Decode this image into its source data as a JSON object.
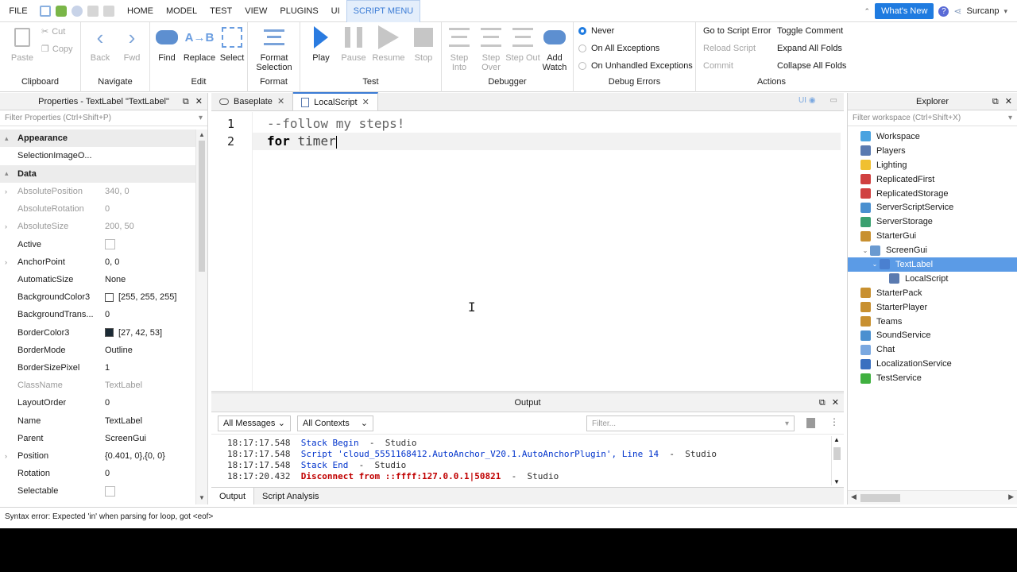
{
  "menu": {
    "file": "FILE",
    "tabs": [
      "HOME",
      "MODEL",
      "TEST",
      "VIEW",
      "PLUGINS",
      "UI",
      "SCRIPT MENU"
    ],
    "active_tab": "SCRIPT MENU",
    "whats_new": "What's New",
    "username": "Surcanp"
  },
  "ribbon": {
    "clipboard": {
      "label": "Clipboard",
      "paste": "Paste",
      "cut": "Cut",
      "copy": "Copy"
    },
    "navigate": {
      "label": "Navigate",
      "back": "Back",
      "fwd": "Fwd"
    },
    "edit": {
      "label": "Edit",
      "find": "Find",
      "replace": "Replace",
      "select": "Select"
    },
    "format": {
      "label": "Format",
      "format_selection": "Format Selection"
    },
    "test": {
      "label": "Test",
      "play": "Play",
      "pause": "Pause",
      "resume": "Resume",
      "stop": "Stop"
    },
    "debugger": {
      "label": "Debugger",
      "step_into": "Step Into",
      "step_over": "Step Over",
      "step_out": "Step Out",
      "add_watch": "Add Watch"
    },
    "debug_errors": {
      "label": "Debug Errors",
      "never": "Never",
      "on_all": "On All Exceptions",
      "on_unhandled": "On Unhandled Exceptions"
    },
    "actions": {
      "label": "Actions",
      "go_to_error": "Go to Script Error",
      "reload": "Reload Script",
      "commit": "Commit",
      "toggle_comment": "Toggle Comment",
      "expand_folds": "Expand All Folds",
      "collapse_folds": "Collapse All Folds"
    }
  },
  "properties": {
    "title": "Properties - TextLabel \"TextLabel\"",
    "filter_placeholder": "Filter Properties (Ctrl+Shift+P)",
    "rows": [
      {
        "type": "cat",
        "name": "Appearance"
      },
      {
        "name": "SelectionImageO...",
        "value": ""
      },
      {
        "type": "cat",
        "name": "Data"
      },
      {
        "name": "AbsolutePosition",
        "value": "340, 0",
        "ro": true,
        "exp": true
      },
      {
        "name": "AbsoluteRotation",
        "value": "0",
        "ro": true
      },
      {
        "name": "AbsoluteSize",
        "value": "200, 50",
        "ro": true,
        "exp": true
      },
      {
        "name": "Active",
        "value": "",
        "check": true
      },
      {
        "name": "AnchorPoint",
        "value": "0, 0",
        "exp": true
      },
      {
        "name": "AutomaticSize",
        "value": "None"
      },
      {
        "name": "BackgroundColor3",
        "value": "[255, 255, 255]",
        "swatch": "#ffffff"
      },
      {
        "name": "BackgroundTrans...",
        "value": "0"
      },
      {
        "name": "BorderColor3",
        "value": "[27, 42, 53]",
        "swatch": "#1b2a35"
      },
      {
        "name": "BorderMode",
        "value": "Outline"
      },
      {
        "name": "BorderSizePixel",
        "value": "1"
      },
      {
        "name": "ClassName",
        "value": "TextLabel",
        "ro": true
      },
      {
        "name": "LayoutOrder",
        "value": "0"
      },
      {
        "name": "Name",
        "value": "TextLabel"
      },
      {
        "name": "Parent",
        "value": "ScreenGui"
      },
      {
        "name": "Position",
        "value": "{0.401, 0},{0, 0}",
        "exp": true
      },
      {
        "name": "Rotation",
        "value": "0"
      },
      {
        "name": "Selectable",
        "value": "",
        "check": true
      }
    ]
  },
  "editor": {
    "tabs": [
      {
        "label": "Baseplate",
        "icon": "cloud-icon"
      },
      {
        "label": "LocalScript",
        "icon": "script-icon",
        "active": true
      }
    ],
    "ui_toggle": "UI",
    "lines": [
      {
        "num": "1",
        "comment": "--follow my steps!"
      },
      {
        "num": "2",
        "keyword": "for",
        "rest": " timer"
      }
    ]
  },
  "output": {
    "title": "Output",
    "messages_filter": "All Messages",
    "contexts_filter": "All Contexts",
    "filter_placeholder": "Filter...",
    "log": [
      {
        "ts": "18:17:17.548",
        "msg": "Stack Begin",
        "src": "Studio",
        "err": false
      },
      {
        "ts": "18:17:17.548",
        "msg": "Script 'cloud_5551168412.AutoAnchor_V20.1.AutoAnchorPlugin', Line 14",
        "src": "Studio",
        "err": false
      },
      {
        "ts": "18:17:17.548",
        "msg": "Stack End",
        "src": "Studio",
        "err": false
      },
      {
        "ts": "18:17:20.432",
        "msg": "Disconnect from ::ffff:127.0.0.1|50821",
        "src": "Studio",
        "err": true
      }
    ],
    "tabs": [
      "Output",
      "Script Analysis"
    ]
  },
  "explorer": {
    "title": "Explorer",
    "filter_placeholder": "Filter workspace (Ctrl+Shift+X)",
    "items": [
      {
        "label": "Workspace",
        "indent": 0,
        "color": "#4aa3e0"
      },
      {
        "label": "Players",
        "indent": 0,
        "color": "#5a7ab0"
      },
      {
        "label": "Lighting",
        "indent": 0,
        "color": "#f0c030"
      },
      {
        "label": "ReplicatedFirst",
        "indent": 0,
        "color": "#d04040"
      },
      {
        "label": "ReplicatedStorage",
        "indent": 0,
        "color": "#d04040"
      },
      {
        "label": "ServerScriptService",
        "indent": 0,
        "color": "#4a90d0"
      },
      {
        "label": "ServerStorage",
        "indent": 0,
        "color": "#3aa070"
      },
      {
        "label": "StarterGui",
        "indent": 0,
        "color": "#c89030"
      },
      {
        "label": "ScreenGui",
        "indent": 1,
        "color": "#6a9ad0",
        "caret": "open"
      },
      {
        "label": "TextLabel",
        "indent": 2,
        "color": "#4a80d0",
        "caret": "open",
        "selected": true
      },
      {
        "label": "LocalScript",
        "indent": 3,
        "color": "#5a7ab0"
      },
      {
        "label": "StarterPack",
        "indent": 0,
        "color": "#c89030"
      },
      {
        "label": "StarterPlayer",
        "indent": 0,
        "color": "#c89030"
      },
      {
        "label": "Teams",
        "indent": 0,
        "color": "#c89030"
      },
      {
        "label": "SoundService",
        "indent": 0,
        "color": "#4a90d0"
      },
      {
        "label": "Chat",
        "indent": 0,
        "color": "#7aa8e0"
      },
      {
        "label": "LocalizationService",
        "indent": 0,
        "color": "#3a70c0"
      },
      {
        "label": "TestService",
        "indent": 0,
        "color": "#40b040"
      }
    ]
  },
  "status": {
    "text": "Syntax error: Expected 'in' when parsing for loop, got <eof>"
  }
}
